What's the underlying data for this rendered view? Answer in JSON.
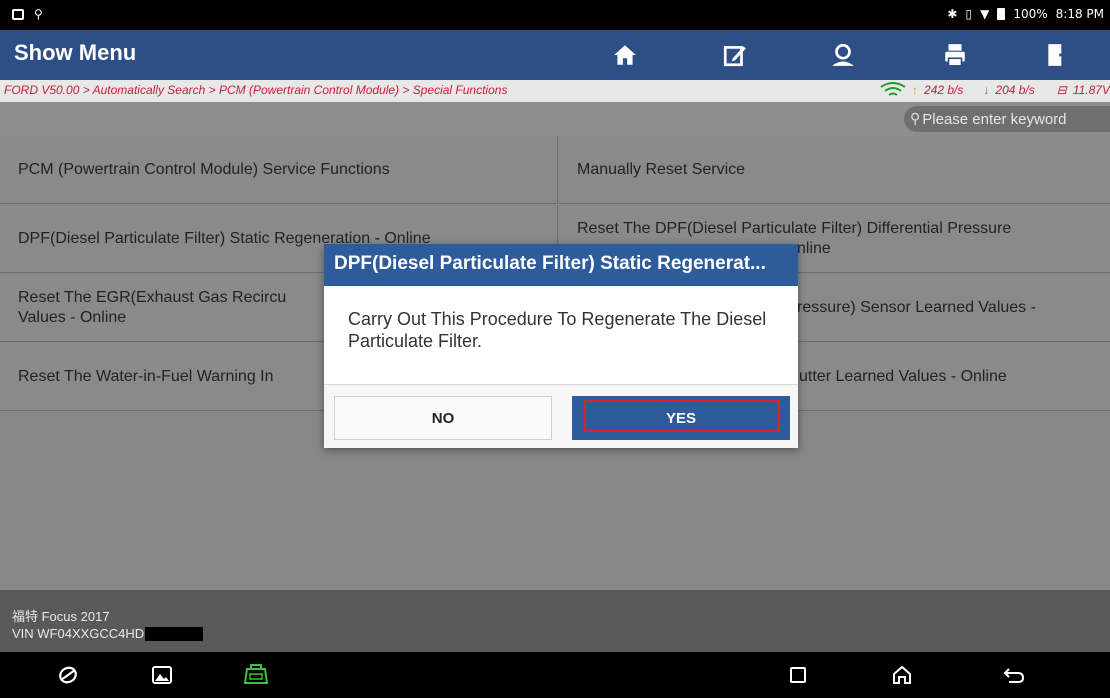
{
  "status_bar": {
    "battery": "100%",
    "time": "8:18 PM"
  },
  "header": {
    "title": "Show Menu"
  },
  "toolbar": [
    {
      "name": "home-button",
      "icon": "home-icon"
    },
    {
      "name": "report-button",
      "icon": "edit-icon"
    },
    {
      "name": "user-button",
      "icon": "person-icon"
    },
    {
      "name": "print-button",
      "icon": "printer-icon"
    },
    {
      "name": "exit-button",
      "icon": "exit-icon"
    }
  ],
  "breadcrumb": {
    "path": "FORD V50.00 > Automatically Search > PCM (Powertrain Control Module) > Special Functions",
    "upload": "242 b/s",
    "download": "204 b/s",
    "voltage": "11.87V"
  },
  "search": {
    "placeholder": "Please enter keyword"
  },
  "functions": {
    "left": [
      "PCM (Powertrain Control Module) Service Functions",
      "DPF(Diesel Particulate Filter) Static Regeneration - Online",
      "Reset The EGR(Exhaust Gas Recircu",
      "Values - Online",
      "Reset The Water-in-Fuel Warning In"
    ],
    "right": [
      "Manually Reset Service",
      "Reset The DPF(Diesel Particulate Filter) Differential Pressure",
      "nline",
      "ressure) Sensor Learned Values -",
      "utter Learned Values - Online"
    ]
  },
  "vehicle": {
    "model": "福特 Focus 2017",
    "vin": "VIN WF04XXGCC4HD"
  },
  "dialog": {
    "title": "DPF(Diesel Particulate Filter) Static Regenerat...",
    "message": "Carry Out This Procedure To Regenerate The Diesel Particulate Filter.",
    "no_label": "NO",
    "yes_label": "YES"
  },
  "colors": {
    "header": "#2e4f86",
    "dialog_title": "#2e5b9a",
    "breadcrumb_text": "#c2203a",
    "highlight": "#e0202e"
  }
}
